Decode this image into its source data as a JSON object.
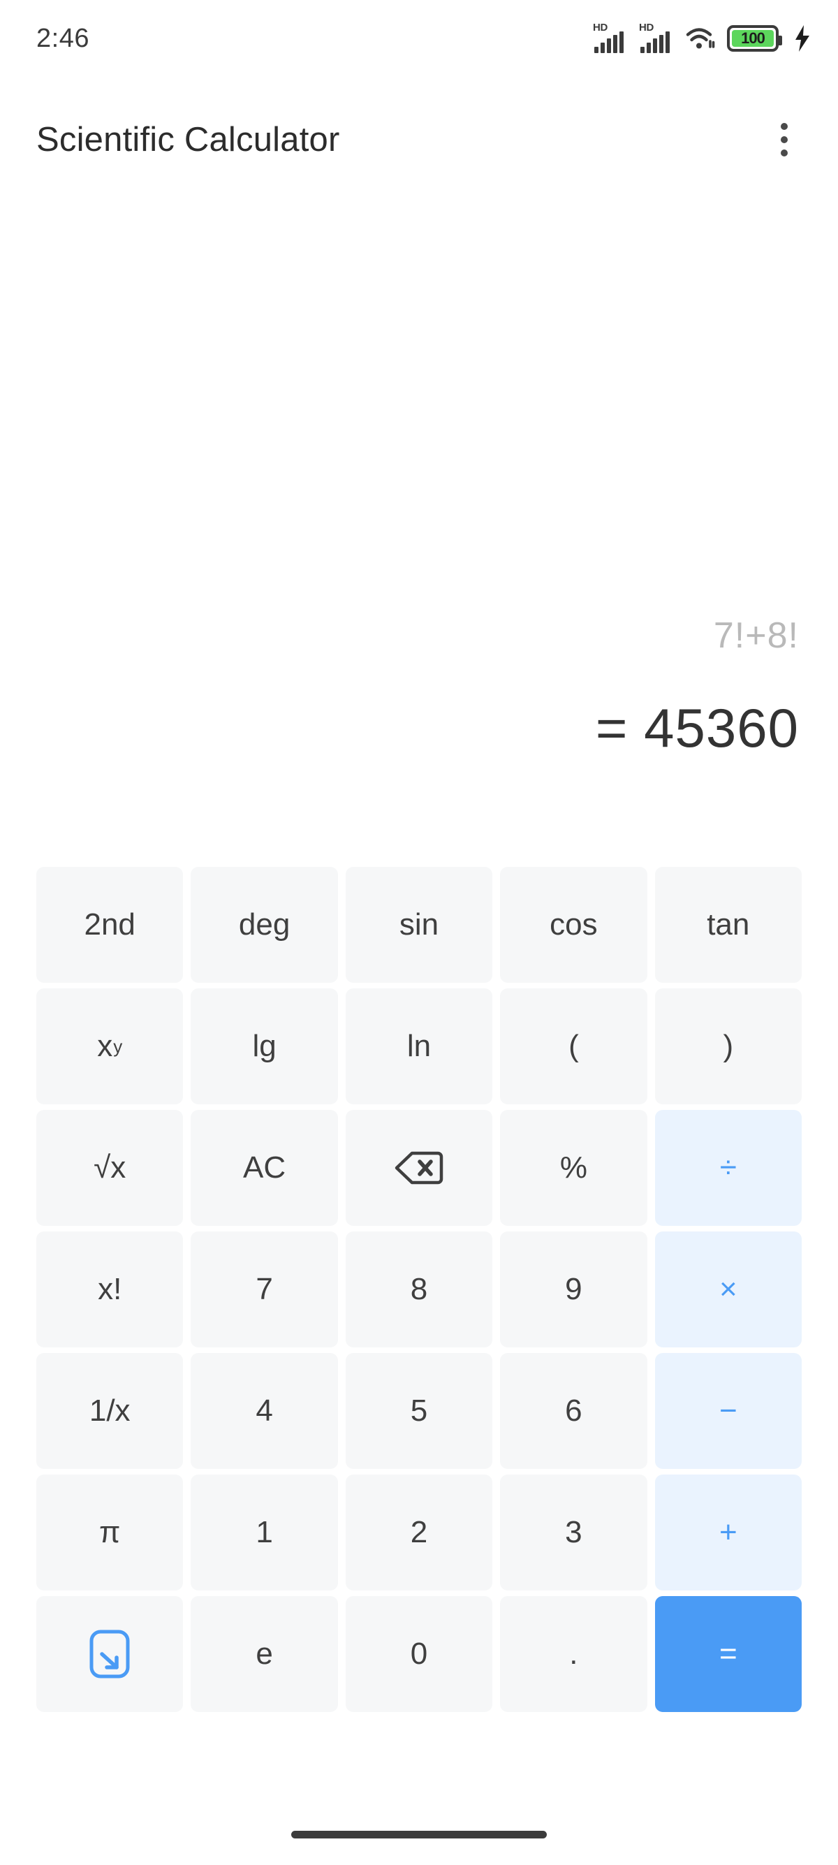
{
  "status_bar": {
    "time": "2:46",
    "signal_1": {
      "icon": "signal-hd-icon",
      "label": "HD"
    },
    "signal_2": {
      "icon": "signal-hd-icon",
      "label": "HD"
    },
    "wifi": {
      "icon": "wifi-icon"
    },
    "battery": {
      "icon": "battery-icon",
      "level": "100",
      "fill_color": "#5cd65c"
    },
    "charging": {
      "icon": "charging-bolt-icon"
    }
  },
  "app_bar": {
    "title": "Scientific Calculator",
    "overflow": {
      "icon": "overflow-menu-icon",
      "label": "More options"
    }
  },
  "display": {
    "expression": "7!+8!",
    "result": "= 45360"
  },
  "colors": {
    "accent": "#4a9bf5",
    "operator_bg": "#eaf3fe",
    "key_bg": "#f6f7f8",
    "text": "#3f3f3f",
    "expression_text": "#b9b9b9"
  },
  "keypad": {
    "rows": [
      [
        {
          "label": "2nd",
          "type": "function"
        },
        {
          "label": "deg",
          "type": "function"
        },
        {
          "label": "sin",
          "type": "function"
        },
        {
          "label": "cos",
          "type": "function"
        },
        {
          "label": "tan",
          "type": "function"
        }
      ],
      [
        {
          "label": "x",
          "sup": "y",
          "type": "function",
          "name": "power"
        },
        {
          "label": "lg",
          "type": "function"
        },
        {
          "label": "ln",
          "type": "function"
        },
        {
          "label": "(",
          "type": "function"
        },
        {
          "label": ")",
          "type": "function"
        }
      ],
      [
        {
          "label": "√x",
          "type": "function",
          "name": "square-root"
        },
        {
          "label": "AC",
          "type": "function",
          "name": "all-clear"
        },
        {
          "label": "",
          "type": "icon",
          "icon": "backspace-icon",
          "name": "backspace"
        },
        {
          "label": "%",
          "type": "function",
          "name": "percent"
        },
        {
          "label": "÷",
          "type": "operator",
          "name": "divide"
        }
      ],
      [
        {
          "label": "x!",
          "type": "function",
          "name": "factorial"
        },
        {
          "label": "7",
          "type": "digit"
        },
        {
          "label": "8",
          "type": "digit"
        },
        {
          "label": "9",
          "type": "digit"
        },
        {
          "label": "×",
          "type": "operator",
          "name": "multiply"
        }
      ],
      [
        {
          "label": "1/x",
          "type": "function",
          "name": "reciprocal"
        },
        {
          "label": "4",
          "type": "digit"
        },
        {
          "label": "5",
          "type": "digit"
        },
        {
          "label": "6",
          "type": "digit"
        },
        {
          "label": "−",
          "type": "operator",
          "name": "subtract"
        }
      ],
      [
        {
          "label": "π",
          "type": "function",
          "name": "pi"
        },
        {
          "label": "1",
          "type": "digit"
        },
        {
          "label": "2",
          "type": "digit"
        },
        {
          "label": "3",
          "type": "digit"
        },
        {
          "label": "+",
          "type": "operator",
          "name": "add"
        }
      ],
      [
        {
          "label": "",
          "type": "icon",
          "icon": "collapse-keypad-icon",
          "name": "collapse-keypad"
        },
        {
          "label": "e",
          "type": "function",
          "name": "euler"
        },
        {
          "label": "0",
          "type": "digit"
        },
        {
          "label": ".",
          "type": "function",
          "name": "decimal-point"
        },
        {
          "label": "=",
          "type": "equals",
          "name": "equals"
        }
      ]
    ]
  },
  "navigation": {
    "home_indicator": "home-indicator"
  }
}
